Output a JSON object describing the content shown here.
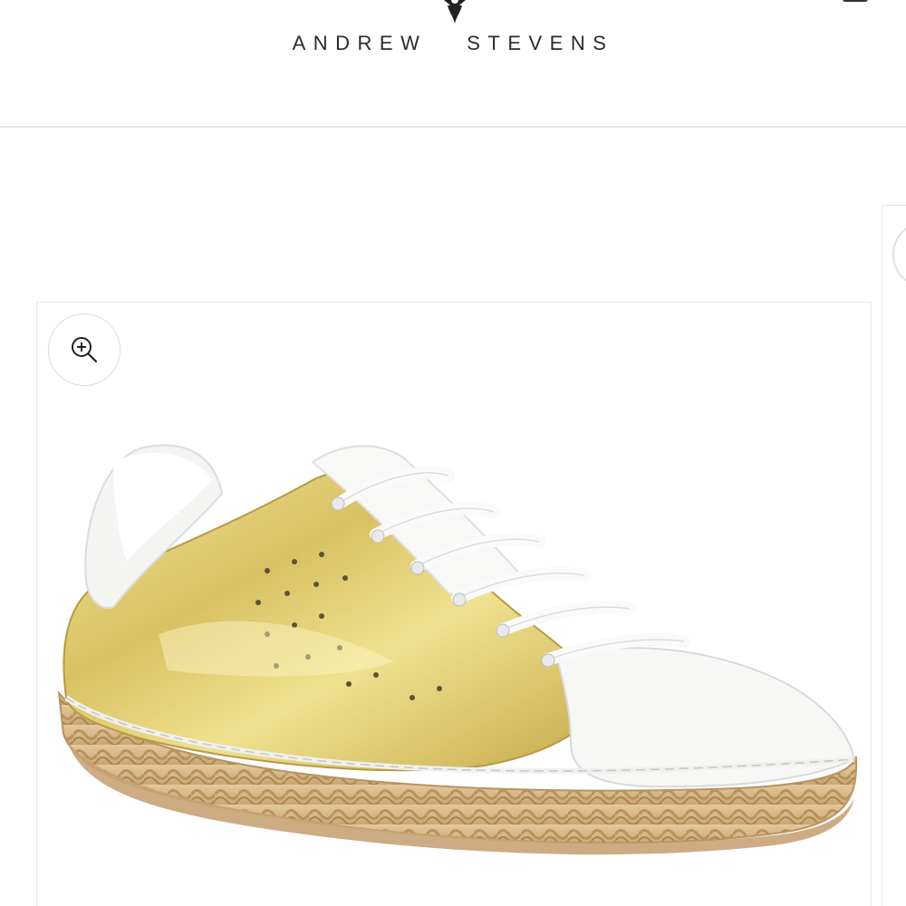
{
  "header": {
    "brand_name": "ANDREW   STEVENS",
    "logo_icon": "fleur-de-lis-logo",
    "corner_icon": "bag-icon"
  },
  "product": {
    "zoom_icon": "zoom-in-icon",
    "image_subject": "gold-and-white-espadrille-sneaker"
  },
  "colors": {
    "brand_text": "#2b2b2b",
    "divider": "#e7e7e7",
    "card_border": "#e6e6e6",
    "gold": "#d9c466",
    "jute": "#d8b98a"
  }
}
